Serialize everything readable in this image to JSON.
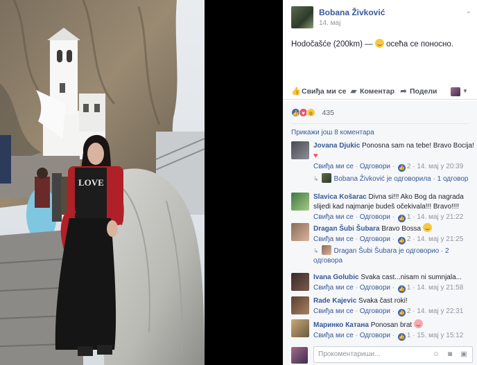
{
  "post": {
    "author": "Bobana Živković",
    "date": "14. мај",
    "chevron": "⌄",
    "text": "Hodočašće (200km) — ",
    "feeling": "осећа се поносно."
  },
  "photo": {
    "shirt_text": "LOVE",
    "shirt_subtext": "YOU TAKE\nMEDICAL TO THE\nLOVE"
  },
  "actions": {
    "like": "Свиђа ми се",
    "comment": "Коментар",
    "share": "Подели"
  },
  "reactions": {
    "count": "435"
  },
  "prev_comments": "Прикажи још 8 коментара",
  "comments": [
    {
      "name": "Jovana Djukic",
      "text": "Ponosna sam na tebe! Bravo Bocija!",
      "like": "Свиђа ми се",
      "reply": "Одговори",
      "likes": "2",
      "time": "14. мај у 20:39",
      "reply_info": "Bobana Živković је одговорила",
      "reply_count": "1 одговор"
    },
    {
      "name": "Slavica Košarac",
      "text": "Divna si!!! Ako Bog da nagrada slijedi kad najmanje budeš očekivala!!! Bravo!!!!",
      "like": "Свиђа ми се",
      "reply": "Одговори",
      "likes": "1",
      "time": "14. мај у 21:22"
    },
    {
      "name": "Dragan Šubi Šubara",
      "text": "Bravo Bossa",
      "like": "Свиђа ми се",
      "reply": "Одговори",
      "likes": "2",
      "time": "14. мај у 21:25",
      "reply_info": "Dragan Šubi Šubara је одговорио",
      "reply_count": "2 одговора"
    },
    {
      "name": "Ivana Golubic",
      "text": "Svaka cast...nisam ni sumnjala...",
      "like": "Свиђа ми се",
      "reply": "Одговори",
      "likes": "1",
      "time": "14. мај у 21:58"
    },
    {
      "name": "Rade Kajevic",
      "text": "Svaka čast roki!",
      "like": "Свиђа ми се",
      "reply": "Одговори",
      "likes": "2",
      "time": "14. мај у 22:31"
    },
    {
      "name": "Маринко Катана",
      "text": "Ponosan brat",
      "like": "Свиђа ми се",
      "reply": "Одговори",
      "likes": "1",
      "time": "15. мај у 15:12"
    }
  ],
  "comment_input": {
    "placeholder": "Прокоментариши..."
  },
  "colors": {
    "link": "#365899",
    "like_blue": "#4267b2",
    "love_red": "#f25268",
    "wow_yellow": "#f7c940"
  }
}
